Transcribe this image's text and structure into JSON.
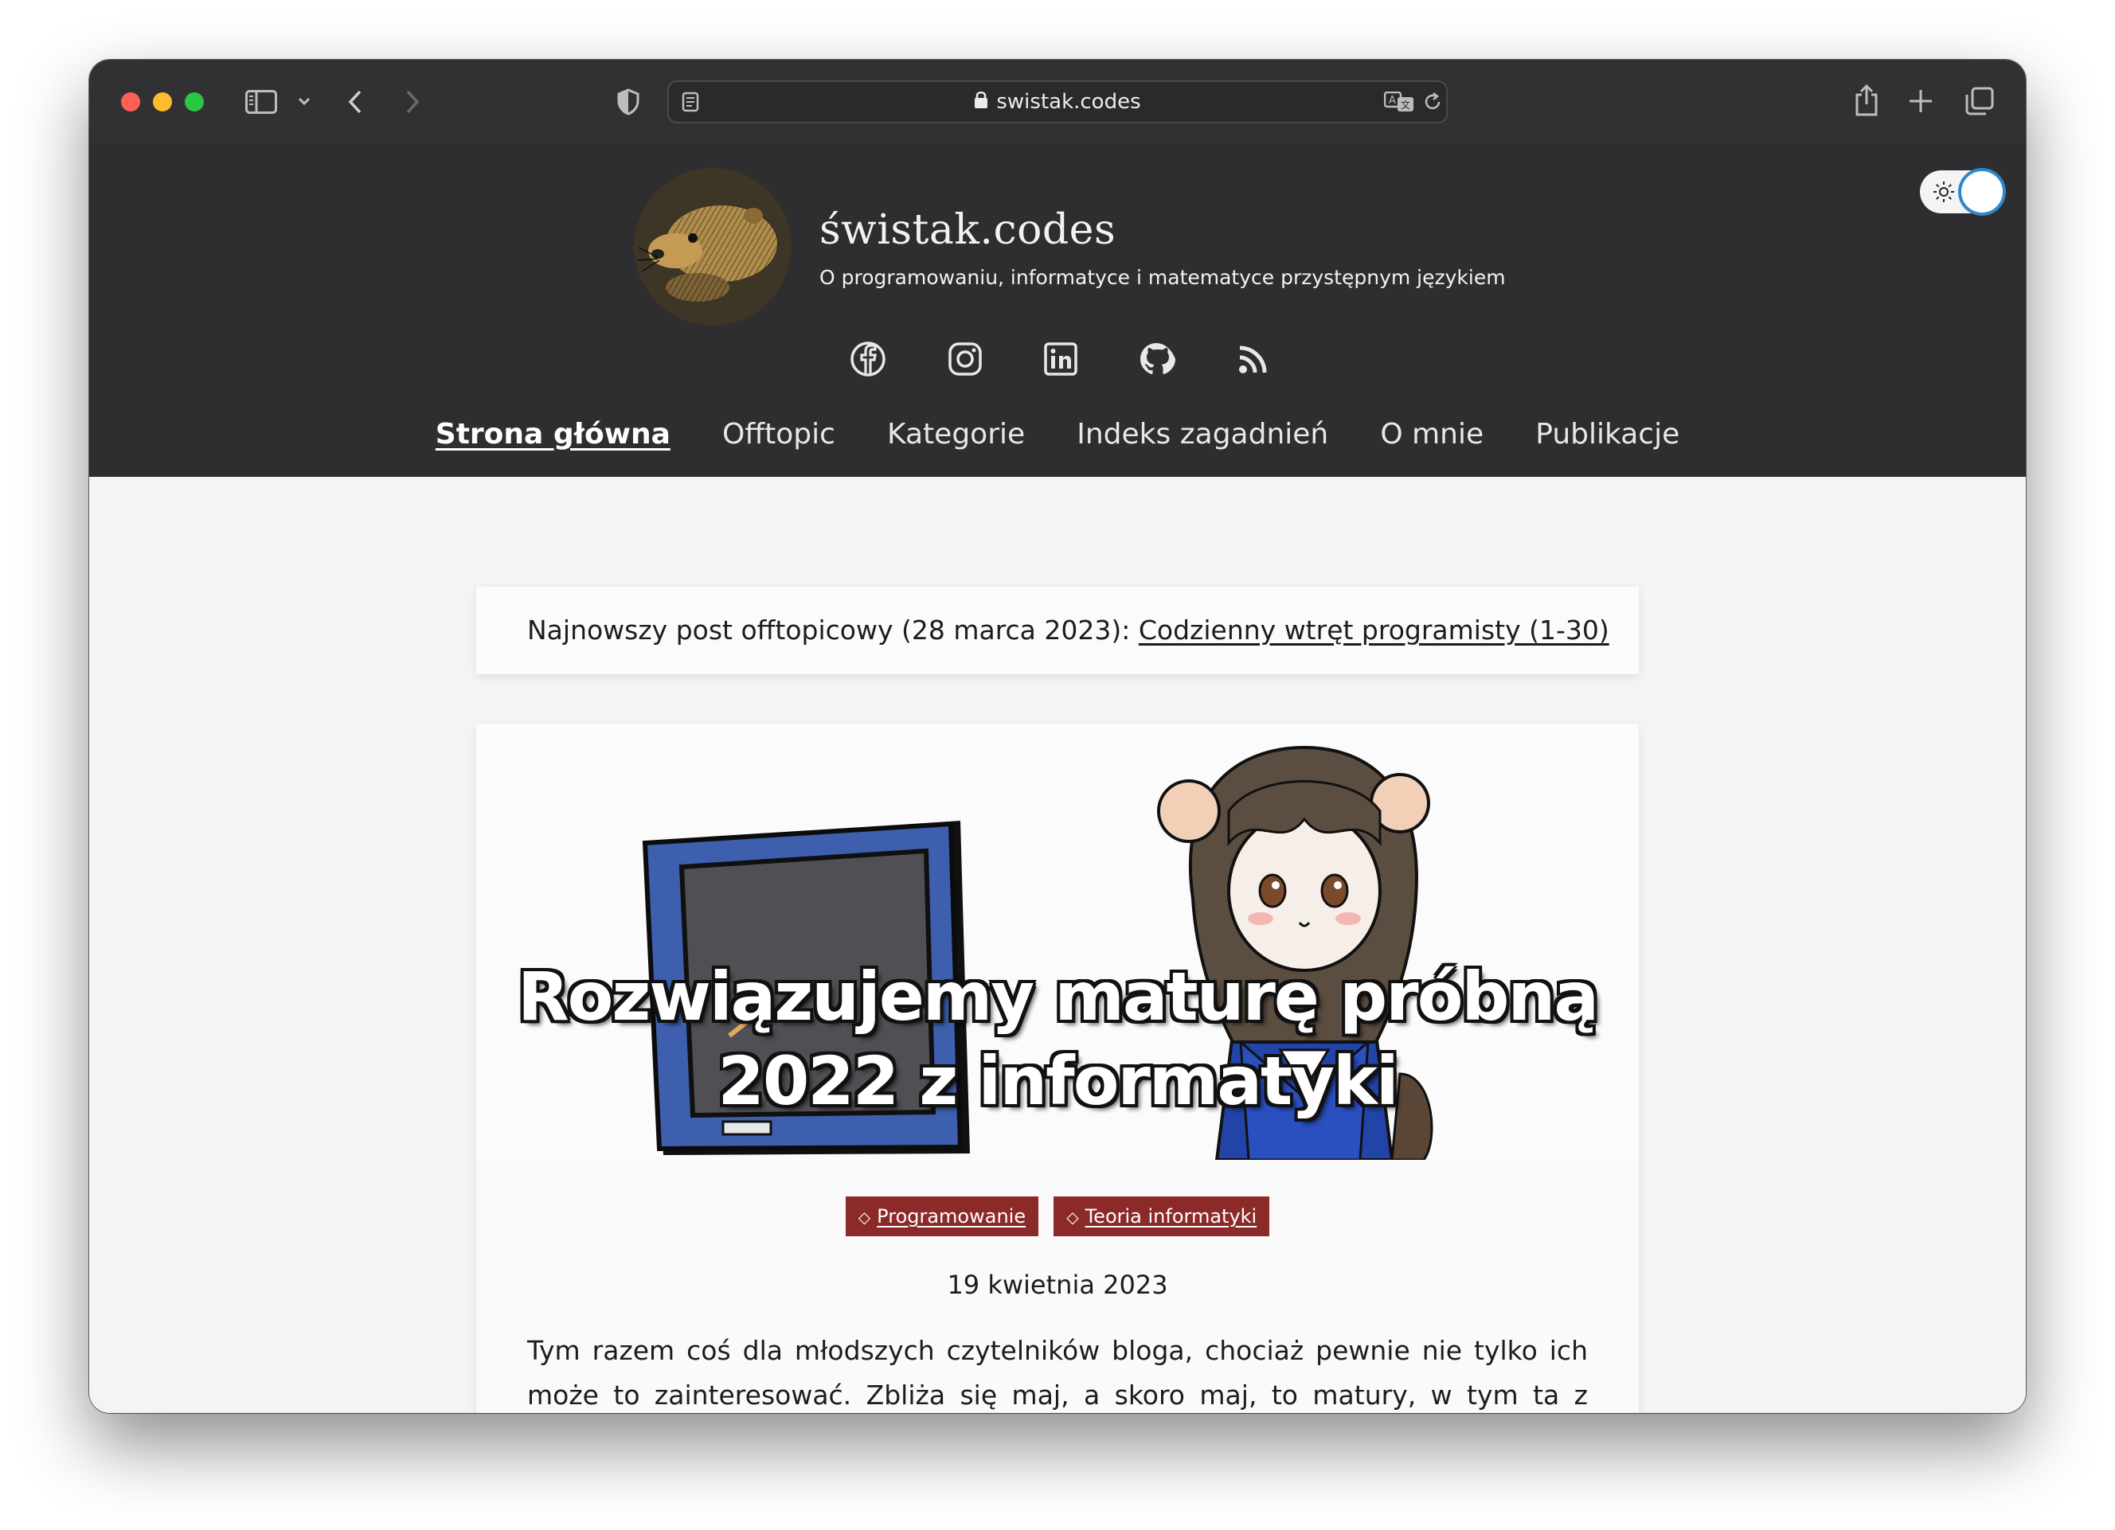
{
  "browser": {
    "url": "swistak.codes"
  },
  "site": {
    "title": "świstak.codes",
    "subtitle": "O programowaniu, informatyce i matematyce przystępnym językiem"
  },
  "social": [
    "facebook-icon",
    "instagram-icon",
    "linkedin-icon",
    "github-icon",
    "rss-icon"
  ],
  "nav": {
    "items": [
      "Strona główna",
      "Offtopic",
      "Kategorie",
      "Indeks zagadnień",
      "O mnie",
      "Publikacje"
    ],
    "active": "Strona główna"
  },
  "notice": {
    "text": "Najnowszy post offtopicowy (28 marca 2023): ",
    "link": "Codzienny wtręt programisty (1-30)"
  },
  "post": {
    "title_line1": "Rozwiązujemy maturę próbną",
    "title_line2": "2022 z informatyki",
    "tags": [
      "Programowanie",
      "Teoria informatyki"
    ],
    "date": "19 kwietnia 2023",
    "excerpt": "Tym razem coś dla młodszych czytelników bloga, chociaż pewnie nie tylko ich może to zainteresować. Zbliża się maj, a skoro maj, to matury, w tym ta z informatyki. Pomyślałem, że może Was zaciekawić, jak osoba pracująca od kilku lat w IT rozwiązałaby zadania z matury z informatyki, a konkretniej z próbnej matury z 2022 roku."
  },
  "colors": {
    "header_bg": "#2e2e30",
    "tag_bg": "#8c2a2a",
    "toggle_ring": "#2f86c9"
  }
}
